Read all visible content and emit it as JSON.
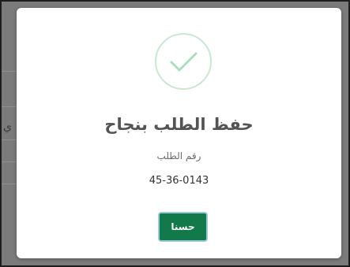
{
  "dialog": {
    "title": "حفظ الطلب بنجاح",
    "order_label": "رقم الطلب",
    "order_number": "45-36-0143",
    "ok_label": "حسنا",
    "icon": "checkmark-icon"
  },
  "background": {
    "partial_glyph": "ي"
  },
  "colors": {
    "success": "#a9dfbf",
    "button": "#127a4a",
    "overlay": "#7b7b7b"
  }
}
